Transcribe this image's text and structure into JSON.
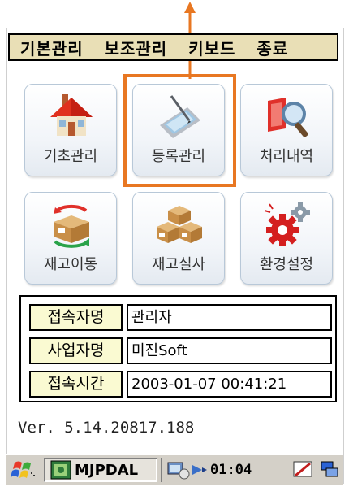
{
  "menu": [
    "기본관리",
    "보조관리",
    "키보드",
    "종료"
  ],
  "tiles": [
    {
      "label": "기초관리",
      "icon": "house-icon"
    },
    {
      "label": "등록관리",
      "icon": "pda-pen-icon"
    },
    {
      "label": "처리내역",
      "icon": "magnifier-icon"
    },
    {
      "label": "재고이동",
      "icon": "box-exchange-icon"
    },
    {
      "label": "재고실사",
      "icon": "boxes-icon"
    },
    {
      "label": "환경설정",
      "icon": "gears-icon"
    }
  ],
  "info": [
    {
      "label": "접속자명",
      "value": "관리자"
    },
    {
      "label": "사업자명",
      "value": "미진Soft"
    },
    {
      "label": "접속시간",
      "value": "2003-01-07 00:41:21"
    }
  ],
  "version": "Ver. 5.14.20817.188",
  "taskbar": {
    "app_name": "MJPDAL",
    "clock": "01:04"
  },
  "colors": {
    "menubar_bg": "#e9dfb6",
    "highlight": "#e87722",
    "label_bg": "#fafad2",
    "taskbar_bg": "#d4d0c8"
  }
}
